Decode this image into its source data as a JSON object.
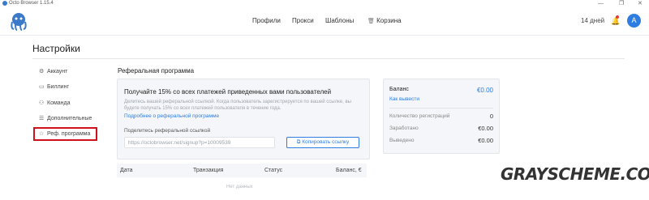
{
  "window": {
    "title": "Octo Browser 1.15.4",
    "controls": [
      "—",
      "❐",
      "✕"
    ]
  },
  "nav": {
    "items": [
      {
        "label": "Профили"
      },
      {
        "label": "Прокси"
      },
      {
        "label": "Шаблоны"
      },
      {
        "label": "Корзина",
        "icon": "trash-icon"
      }
    ],
    "days": "14 дней",
    "avatar_letter": "A"
  },
  "page": {
    "title": "Настройки"
  },
  "sidebar": {
    "items": [
      {
        "label": "Аккаунт",
        "icon": "gear-icon"
      },
      {
        "label": "Биллинг",
        "icon": "wallet-icon"
      },
      {
        "label": "Команда",
        "icon": "team-icon"
      },
      {
        "label": "Дополнительные",
        "icon": "sliders-icon"
      },
      {
        "label": "Реф. программа",
        "icon": "star-icon",
        "active": true
      }
    ]
  },
  "referral": {
    "section_title": "Реферальная программа",
    "headline": "Получайте 15% со всех платежей приведенных вами пользователей",
    "description": "Делитесь вашей реферальной ссылкой. Когда пользователь зарегистрируется по вашей ссылке, вы будете получать 15% со всех платежей пользователя в течение года.",
    "more_link": "Подробнее о реферальной программе",
    "share_label": "Поделитесь реферальной ссылкой",
    "link_value": "https://octobrowser.net/signup?p=10009539",
    "copy_button": "Копировать ссылку"
  },
  "balance": {
    "label": "Баланс",
    "value": "€0.00",
    "withdraw_link": "Как вывести",
    "rows": [
      {
        "label": "Количество регистраций",
        "value": "0"
      },
      {
        "label": "Заработано",
        "value": "€0.00"
      },
      {
        "label": "Выведено",
        "value": "€0.00"
      }
    ]
  },
  "table": {
    "columns": [
      "Дата",
      "Транзакция",
      "Статус",
      "Баланс, €"
    ],
    "empty_text": "Нет данных"
  },
  "watermark": "GRAYSCHEME.COM",
  "colors": {
    "accent": "#2f7de1",
    "highlight": "#d0111b"
  }
}
